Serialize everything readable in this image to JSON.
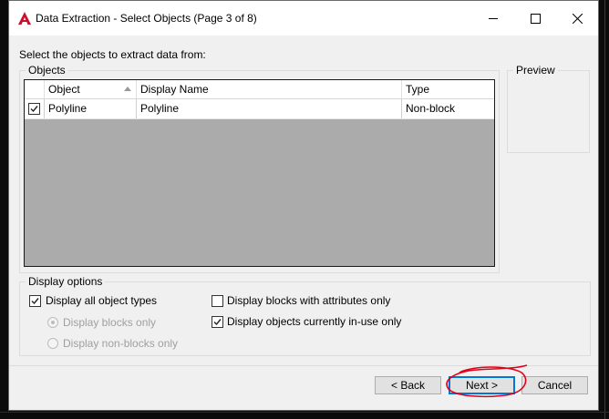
{
  "window": {
    "title": "Data Extraction - Select Objects (Page 3 of 8)"
  },
  "instruction": "Select the objects to extract data from:",
  "objects_group": {
    "title": "Objects",
    "columns": [
      "Object",
      "Display Name",
      "Type"
    ],
    "rows": [
      {
        "checked": true,
        "object": "Polyline",
        "display_name": "Polyline",
        "type": "Non-block"
      }
    ]
  },
  "preview_group": {
    "title": "Preview"
  },
  "display_options": {
    "title": "Display options",
    "all_types": {
      "label": "Display all object types",
      "checked": true
    },
    "blocks_only": {
      "label": "Display blocks only",
      "selected": true,
      "enabled": false
    },
    "non_blocks_only": {
      "label": "Display non-blocks only",
      "selected": false,
      "enabled": false
    },
    "blocks_with_attrs": {
      "label": "Display blocks with attributes only",
      "checked": false
    },
    "in_use": {
      "label": "Display objects currently in-use only",
      "checked": true
    }
  },
  "buttons": {
    "back": "< Back",
    "next": "Next >",
    "cancel": "Cancel"
  },
  "annotation": {
    "color": "#e0001a"
  },
  "icons": {
    "app": "autocad-logo-icon",
    "minimize": "minimize-icon",
    "maximize": "maximize-icon",
    "close": "close-icon"
  }
}
